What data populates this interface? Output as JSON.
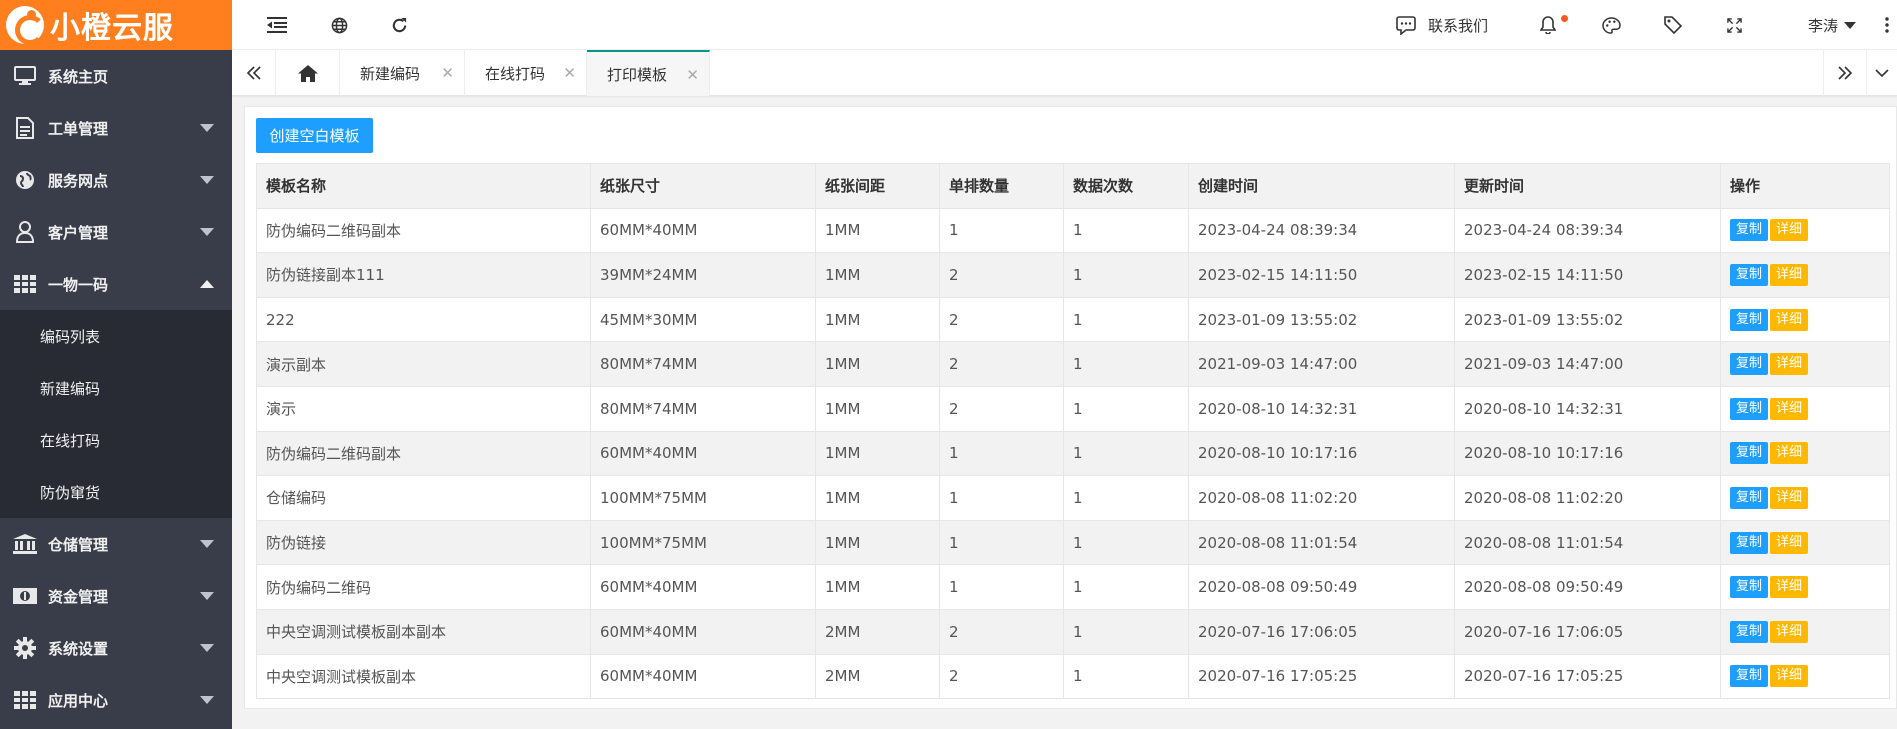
{
  "brand": {
    "name": "小橙云服",
    "color": "#FF7E1E"
  },
  "sidebar": {
    "bg": "#393D49",
    "items": [
      {
        "label": "系统主页",
        "icon": "monitor-icon",
        "expandable": false
      },
      {
        "label": "工单管理",
        "icon": "document-icon",
        "expandable": true
      },
      {
        "label": "服务网点",
        "icon": "globe-icon",
        "expandable": true
      },
      {
        "label": "客户管理",
        "icon": "user-icon",
        "expandable": true
      },
      {
        "label": "一物一码",
        "icon": "grid-icon",
        "expandable": true,
        "expanded": true,
        "children": [
          {
            "label": "编码列表"
          },
          {
            "label": "新建编码"
          },
          {
            "label": "在线打码"
          },
          {
            "label": "防伪窜货"
          }
        ]
      },
      {
        "label": "仓储管理",
        "icon": "bank-icon",
        "expandable": true
      },
      {
        "label": "资金管理",
        "icon": "money-icon",
        "expandable": true
      },
      {
        "label": "系统设置",
        "icon": "gear-icon",
        "expandable": true
      },
      {
        "label": "应用中心",
        "icon": "apps-icon",
        "expandable": true
      }
    ]
  },
  "header": {
    "contact_label": "联系我们",
    "user_name": "李涛",
    "icons": [
      "shrink-menu-icon",
      "globe-icon",
      "refresh-icon",
      "chat-icon",
      "bell-icon",
      "palette-icon",
      "tag-icon",
      "fullscreen-icon",
      "more-icon"
    ]
  },
  "tabs": {
    "items": [
      {
        "label": "新建编码",
        "active": false
      },
      {
        "label": "在线打码",
        "active": false
      },
      {
        "label": "打印模板",
        "active": true
      }
    ]
  },
  "content": {
    "create_button": "创建空白模板",
    "columns": [
      "模板名称",
      "纸张尺寸",
      "纸张间距",
      "单排数量",
      "数据次数",
      "创建时间",
      "更新时间",
      "操作"
    ],
    "copy_label": "复制",
    "detail_label": "详细",
    "rows": [
      [
        "防伪编码二维码副本",
        "60MM*40MM",
        "1MM",
        "1",
        "1",
        "2023-04-24 08:39:34",
        "2023-04-24 08:39:34"
      ],
      [
        "防伪链接副本111",
        "39MM*24MM",
        "1MM",
        "2",
        "1",
        "2023-02-15 14:11:50",
        "2023-02-15 14:11:50"
      ],
      [
        "222",
        "45MM*30MM",
        "1MM",
        "2",
        "1",
        "2023-01-09 13:55:02",
        "2023-01-09 13:55:02"
      ],
      [
        "演示副本",
        "80MM*74MM",
        "1MM",
        "2",
        "1",
        "2021-09-03 14:47:00",
        "2021-09-03 14:47:00"
      ],
      [
        "演示",
        "80MM*74MM",
        "1MM",
        "2",
        "1",
        "2020-08-10 14:32:31",
        "2020-08-10 14:32:31"
      ],
      [
        "防伪编码二维码副本",
        "60MM*40MM",
        "1MM",
        "1",
        "1",
        "2020-08-10 10:17:16",
        "2020-08-10 10:17:16"
      ],
      [
        "仓储编码",
        "100MM*75MM",
        "1MM",
        "1",
        "1",
        "2020-08-08 11:02:20",
        "2020-08-08 11:02:20"
      ],
      [
        "防伪链接",
        "100MM*75MM",
        "1MM",
        "1",
        "1",
        "2020-08-08 11:01:54",
        "2020-08-08 11:01:54"
      ],
      [
        "防伪编码二维码",
        "60MM*40MM",
        "1MM",
        "1",
        "1",
        "2020-08-08 09:50:49",
        "2020-08-08 09:50:49"
      ],
      [
        "中央空调测试模板副本副本",
        "60MM*40MM",
        "2MM",
        "2",
        "1",
        "2020-07-16 17:06:05",
        "2020-07-16 17:06:05"
      ],
      [
        "中央空调测试模板副本",
        "60MM*40MM",
        "2MM",
        "2",
        "1",
        "2020-07-16 17:05:25",
        "2020-07-16 17:05:25"
      ]
    ]
  }
}
